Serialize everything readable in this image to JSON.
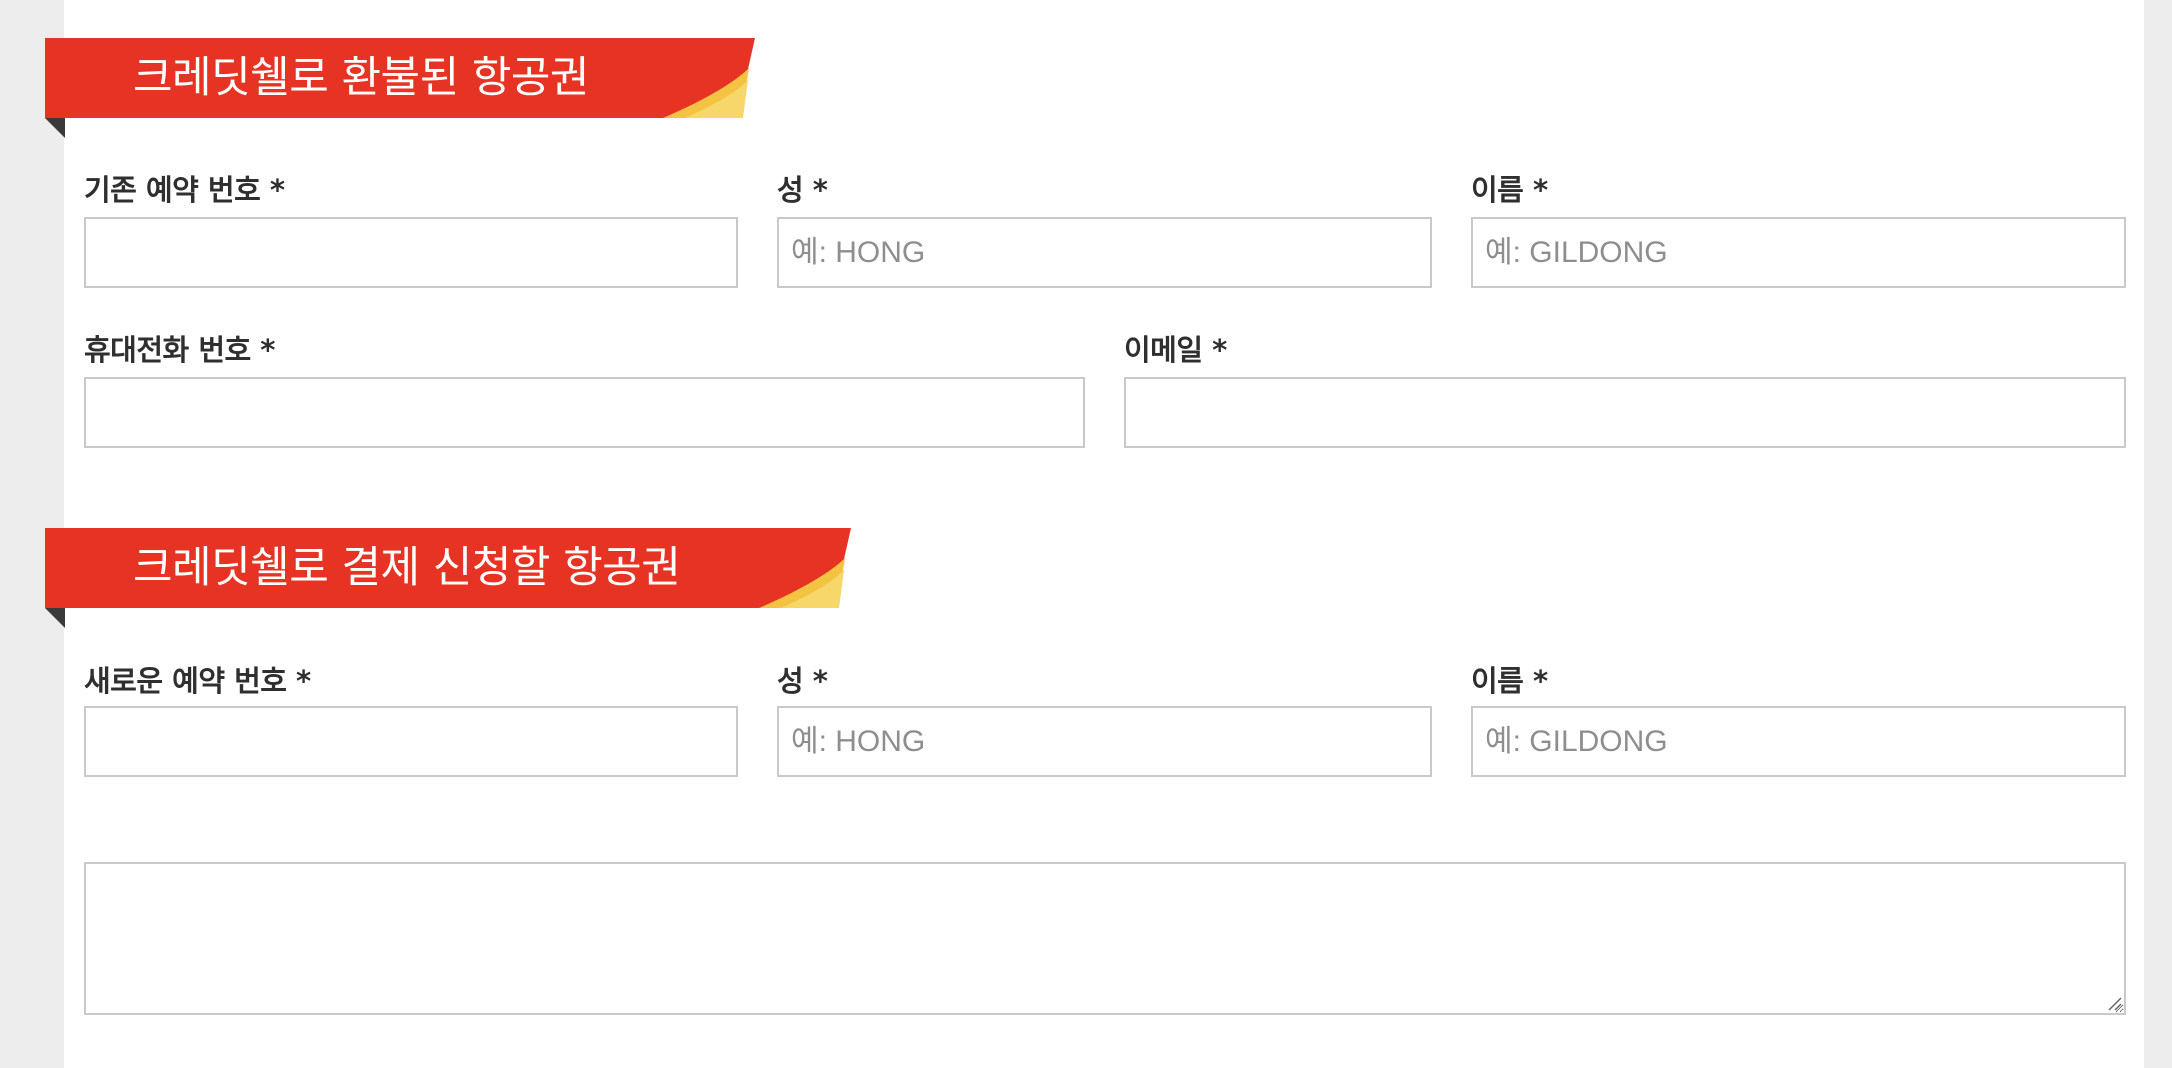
{
  "sections": [
    {
      "title": "크레딧쉘로 환불된 항공권",
      "fields": [
        {
          "label": "기존 예약 번호 *",
          "placeholder": "",
          "value": ""
        },
        {
          "label": "성 *",
          "placeholder": "예: HONG",
          "value": ""
        },
        {
          "label": "이름 *",
          "placeholder": "예: GILDONG",
          "value": ""
        },
        {
          "label": "휴대전화 번호 *",
          "placeholder": "",
          "value": ""
        },
        {
          "label": "이메일 *",
          "placeholder": "",
          "value": ""
        }
      ]
    },
    {
      "title": "크레딧쉘로 결제 신청할 항공권",
      "fields": [
        {
          "label": "새로운 예약 번호 *",
          "placeholder": "",
          "value": ""
        },
        {
          "label": "성 *",
          "placeholder": "예: HONG",
          "value": ""
        },
        {
          "label": "이름 *",
          "placeholder": "예: GILDONG",
          "value": ""
        }
      ]
    }
  ],
  "comment": {
    "placeholder": "",
    "value": ""
  },
  "colors": {
    "page_background": "#ededed",
    "panel_background": "#ffffff",
    "banner_red": "#e63323",
    "banner_accent": "#f5c342",
    "banner_fold": "#3a3a3a",
    "label_text": "#2f2f2f",
    "input_border": "#c9c9c9",
    "placeholder_text": "#8e8e8e"
  }
}
